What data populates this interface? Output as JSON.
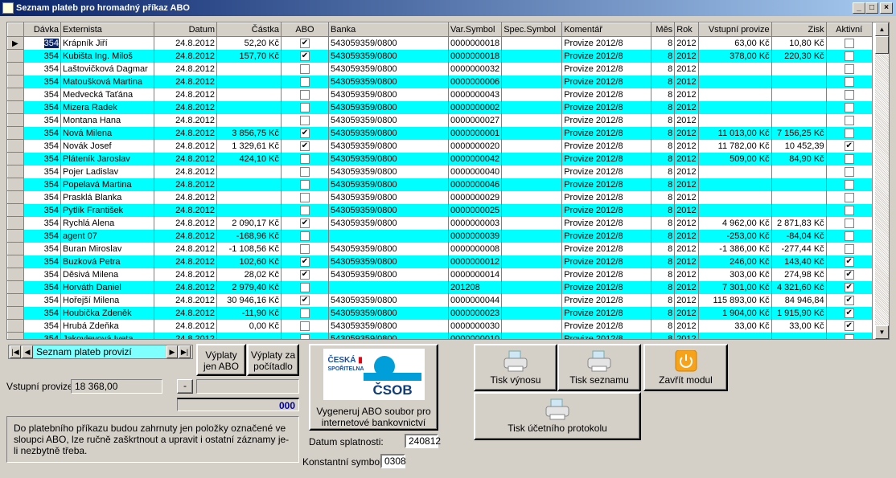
{
  "window": {
    "title": "Seznam plateb pro hromadný příkaz ABO",
    "minimize": "_",
    "maximize": "□",
    "close": "×"
  },
  "colors": {
    "row_alt": "#00ffff",
    "title_bar": "#0a246a",
    "counter_text": "#0000a0"
  },
  "grid": {
    "columns": [
      "Dávka",
      "Externista",
      "Datum",
      "Částka",
      "ABO",
      "Banka",
      "Var.Symbol",
      "Spec.Symbol",
      "Komentář",
      "Měs",
      "Rok",
      "Vstupní provize",
      "Zisk",
      "Aktivní"
    ],
    "rows": [
      [
        "354",
        "Krápník Jiří",
        "24.8.2012",
        "52,20 Kč",
        true,
        "543059359/0800",
        "0000000018",
        "",
        "Provize 2012/8",
        "8",
        "2012",
        "63,00 Kč",
        "10,80 Kč",
        false
      ],
      [
        "354",
        "Kubišta Ing. Miloš",
        "24.8.2012",
        "157,70 Kč",
        true,
        "543059359/0800",
        "0000000018",
        "",
        "Provize 2012/8",
        "8",
        "2012",
        "378,00 Kč",
        "220,30 Kč",
        false
      ],
      [
        "354",
        "Laštovičková Dagmar",
        "24.8.2012",
        "",
        false,
        "543059359/0800",
        "0000000032",
        "",
        "Provize 2012/8",
        "8",
        "2012",
        "",
        "",
        false
      ],
      [
        "354",
        "Matoušková Martina",
        "24.8.2012",
        "",
        false,
        "543059359/0800",
        "0000000006",
        "",
        "Provize 2012/8",
        "8",
        "2012",
        "",
        "",
        false
      ],
      [
        "354",
        "Medvecká Taťána",
        "24.8.2012",
        "",
        false,
        "543059359/0800",
        "0000000043",
        "",
        "Provize 2012/8",
        "8",
        "2012",
        "",
        "",
        false
      ],
      [
        "354",
        "Mizera Radek",
        "24.8.2012",
        "",
        false,
        "543059359/0800",
        "0000000002",
        "",
        "Provize 2012/8",
        "8",
        "2012",
        "",
        "",
        false
      ],
      [
        "354",
        "Montana Hana",
        "24.8.2012",
        "",
        false,
        "543059359/0800",
        "0000000027",
        "",
        "Provize 2012/8",
        "8",
        "2012",
        "",
        "",
        false
      ],
      [
        "354",
        "Nová Milena",
        "24.8.2012",
        "3 856,75 Kč",
        true,
        "543059359/0800",
        "0000000001",
        "",
        "Provize 2012/8",
        "8",
        "2012",
        "11 013,00 Kč",
        "7 156,25 Kč",
        false
      ],
      [
        "354",
        "Novák Josef",
        "24.8.2012",
        "1 329,61 Kč",
        true,
        "543059359/0800",
        "0000000020",
        "",
        "Provize 2012/8",
        "8",
        "2012",
        "11 782,00 Kč",
        "10 452,39",
        true
      ],
      [
        "354",
        "Pláteník Jaroslav",
        "24.8.2012",
        "424,10 Kč",
        false,
        "543059359/0800",
        "0000000042",
        "",
        "Provize 2012/8",
        "8",
        "2012",
        "509,00 Kč",
        "84,90 Kč",
        false
      ],
      [
        "354",
        "Pojer Ladislav",
        "24.8.2012",
        "",
        false,
        "543059359/0800",
        "0000000040",
        "",
        "Provize 2012/8",
        "8",
        "2012",
        "",
        "",
        false
      ],
      [
        "354",
        "Popelavá Martina",
        "24.8.2012",
        "",
        false,
        "543059359/0800",
        "0000000046",
        "",
        "Provize 2012/8",
        "8",
        "2012",
        "",
        "",
        false
      ],
      [
        "354",
        "Prasklá Blanka",
        "24.8.2012",
        "",
        false,
        "543059359/0800",
        "0000000029",
        "",
        "Provize 2012/8",
        "8",
        "2012",
        "",
        "",
        false
      ],
      [
        "354",
        "Pytlík František",
        "24.8.2012",
        "",
        false,
        "543059359/0800",
        "0000000025",
        "",
        "Provize 2012/8",
        "8",
        "2012",
        "",
        "",
        false
      ],
      [
        "354",
        "Rychlá Alena",
        "24.8.2012",
        "2 090,17 Kč",
        true,
        "543059359/0800",
        "0000000003",
        "",
        "Provize 2012/8",
        "8",
        "2012",
        "4 962,00 Kč",
        "2 871,83 Kč",
        false
      ],
      [
        "354",
        "agent 07",
        "24.8.2012",
        "-168,96 Kč",
        false,
        "",
        "0000000039",
        "",
        "Provize 2012/8",
        "8",
        "2012",
        "-253,00 Kč",
        "-84,04 Kč",
        false
      ],
      [
        "354",
        "Buran Miroslav",
        "24.8.2012",
        "-1 108,56 Kč",
        false,
        "543059359/0800",
        "0000000008",
        "",
        "Provize 2012/8",
        "8",
        "2012",
        "-1 386,00 Kč",
        "-277,44 Kč",
        false
      ],
      [
        "354",
        "Buzková Petra",
        "24.8.2012",
        "102,60 Kč",
        true,
        "543059359/0800",
        "0000000012",
        "",
        "Provize 2012/8",
        "8",
        "2012",
        "246,00 Kč",
        "143,40 Kč",
        true
      ],
      [
        "354",
        "Děsivá Milena",
        "24.8.2012",
        "28,02 Kč",
        true,
        "543059359/0800",
        "0000000014",
        "",
        "Provize 2012/8",
        "8",
        "2012",
        "303,00 Kč",
        "274,98 Kč",
        true
      ],
      [
        "354",
        "Horváth Daniel",
        "24.8.2012",
        "2 979,40 Kč",
        false,
        "",
        "201208",
        "",
        "Provize 2012/8",
        "8",
        "2012",
        "7 301,00 Kč",
        "4 321,60 Kč",
        true
      ],
      [
        "354",
        "Hořejší Milena",
        "24.8.2012",
        "30 946,16 Kč",
        true,
        "543059359/0800",
        "0000000044",
        "",
        "Provize 2012/8",
        "8",
        "2012",
        "115 893,00 Kč",
        "84 946,84",
        true
      ],
      [
        "354",
        "Houbička Zdeněk",
        "24.8.2012",
        "-11,90 Kč",
        false,
        "543059359/0800",
        "0000000023",
        "",
        "Provize 2012/8",
        "8",
        "2012",
        "1 904,00 Kč",
        "1 915,90 Kč",
        true
      ],
      [
        "354",
        "Hrubá Zdeňka",
        "24.8.2012",
        "0,00 Kč",
        false,
        "543059359/0800",
        "0000000030",
        "",
        "Provize 2012/8",
        "8",
        "2012",
        "33,00 Kč",
        "33,00 Kč",
        true
      ],
      [
        "354",
        "Jakovlevová Iveta",
        "24.8.2012",
        "",
        false,
        "543059359/0800",
        "0000000010",
        "",
        "Provize 2012/8",
        "8",
        "2012",
        "",
        "",
        false
      ]
    ]
  },
  "nav": {
    "label": "Seznam plateb provizí"
  },
  "buttons": {
    "abo_only": "Výplaty jen ABO",
    "counter": "Výplaty za počítadlo",
    "generate": "Vygeneruj ABO soubor pro internetové bankovnictví",
    "print_yield": "Tisk výnosu",
    "print_list": "Tisk seznamu",
    "close_module": "Zavřít modul",
    "print_protocol": "Tisk účetního protokolu",
    "minus": "-"
  },
  "summary": {
    "label": "Vstupní provize:",
    "value": "18 368,00",
    "counter": "000"
  },
  "info": "Do platebního příkazu budou zahrnuty jen položky označené ve sloupci ABO, lze ručně zaškrtnout a upravit i ostatní záznamy je-li nezbytně třeba.",
  "form": {
    "due_label": "Datum splatnosti:",
    "due_value": "240812",
    "const_label": "Konstantní symbol:",
    "const_value": "0308"
  },
  "logo": {
    "bank1": "ČESKÁ SPOŘITELNA",
    "bank2": "ČSOB"
  }
}
